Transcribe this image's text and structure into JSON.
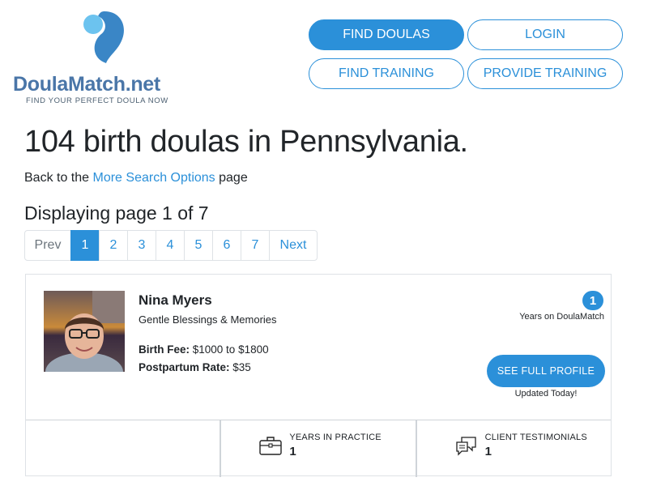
{
  "brand": {
    "name_part1": "DoulaMatch",
    "name_part2": ".net",
    "tagline": "FIND YOUR PERFECT DOULA NOW"
  },
  "nav": {
    "find_doulas": "FIND DOULAS",
    "login": "LOGIN",
    "find_training": "FIND TRAINING",
    "provide_training": "PROVIDE TRAINING"
  },
  "heading": "104 birth doulas in Pennsylvania.",
  "back": {
    "prefix": "Back to the ",
    "link": "More Search Options",
    "suffix": " page"
  },
  "page_indicator": "Displaying page 1 of 7",
  "pagination": {
    "prev": "Prev",
    "pages": [
      "1",
      "2",
      "3",
      "4",
      "5",
      "6",
      "7"
    ],
    "next": "Next",
    "active": "1"
  },
  "listing": {
    "name": "Nina Myers",
    "business": "Gentle Blessings & Memories",
    "birth_fee_label": "Birth Fee:",
    "birth_fee_value": " $1000 to $1800",
    "postpartum_label": "Postpartum Rate:",
    "postpartum_value": " $35",
    "years_on_site": "1",
    "years_on_site_label": "Years on DoulaMatch",
    "profile_button": "SEE FULL PROFILE",
    "updated": "Updated Today!",
    "stats": {
      "years_in_practice_label": "YEARS IN PRACTICE",
      "years_in_practice_value": "1",
      "client_testimonials_label": "CLIENT TESTIMONIALS",
      "client_testimonials_value": "1"
    }
  },
  "colors": {
    "accent": "#2b90d9",
    "text": "#212529",
    "border": "#dee2e6"
  },
  "icons": {
    "brand": "logo-icon",
    "years": "briefcase-icon",
    "testimonials": "chat-bubbles-icon"
  }
}
